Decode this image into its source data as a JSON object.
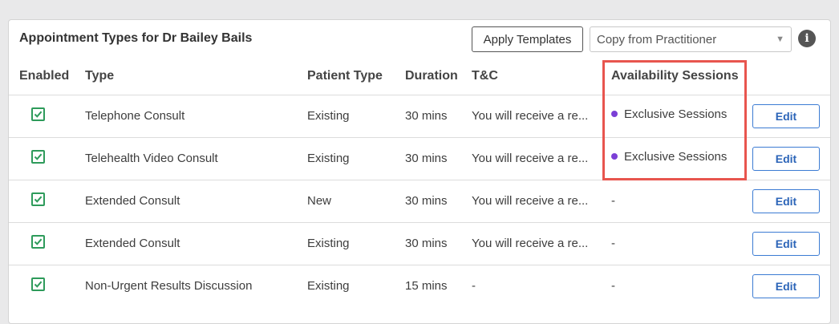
{
  "panel": {
    "title": "Appointment Types for Dr Bailey Bails",
    "apply_label": "Apply Templates",
    "copy_select_value": "Copy from Practitioner",
    "caret": "▼",
    "info_glyph": "i"
  },
  "columns": {
    "enabled": "Enabled",
    "type": "Type",
    "patient_type": "Patient Type",
    "duration": "Duration",
    "tc": "T&C",
    "availability": "Availability Sessions"
  },
  "rows": [
    {
      "enabled": true,
      "type": "Telephone Consult",
      "patient_type": "Existing",
      "duration": "30 mins",
      "tc": "You will receive a re...",
      "availability": "Exclusive Sessions",
      "has_dot": true,
      "edit": "Edit"
    },
    {
      "enabled": true,
      "type": "Telehealth Video Consult",
      "patient_type": "Existing",
      "duration": "30 mins",
      "tc": "You will receive a re...",
      "availability": "Exclusive Sessions",
      "has_dot": true,
      "edit": "Edit"
    },
    {
      "enabled": true,
      "type": "Extended Consult",
      "patient_type": "New",
      "duration": "30 mins",
      "tc": "You will receive a re...",
      "availability": "-",
      "has_dot": false,
      "edit": "Edit"
    },
    {
      "enabled": true,
      "type": "Extended Consult",
      "patient_type": "Existing",
      "duration": "30 mins",
      "tc": "You will receive a re...",
      "availability": "-",
      "has_dot": false,
      "edit": "Edit"
    },
    {
      "enabled": true,
      "type": "Non-Urgent Results Discussion",
      "patient_type": "Existing",
      "duration": "15 mins",
      "tc": "-",
      "availability": "-",
      "has_dot": false,
      "edit": "Edit"
    }
  ],
  "colors": {
    "check_green": "#2e9b5b",
    "session_dot": "#7b3fd6",
    "highlight_red": "#e8554e",
    "edit_blue": "#2b64b8"
  }
}
